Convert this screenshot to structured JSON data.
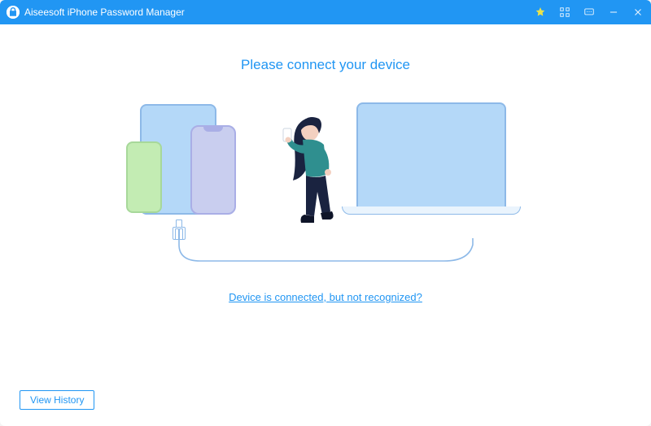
{
  "titlebar": {
    "app_title": "Aiseesoft iPhone Password Manager"
  },
  "main": {
    "instruction": "Please connect your device",
    "help_link_label": "Device is connected, but not recognized?"
  },
  "footer": {
    "view_history_label": "View History"
  },
  "colors": {
    "accent": "#2196f3"
  }
}
